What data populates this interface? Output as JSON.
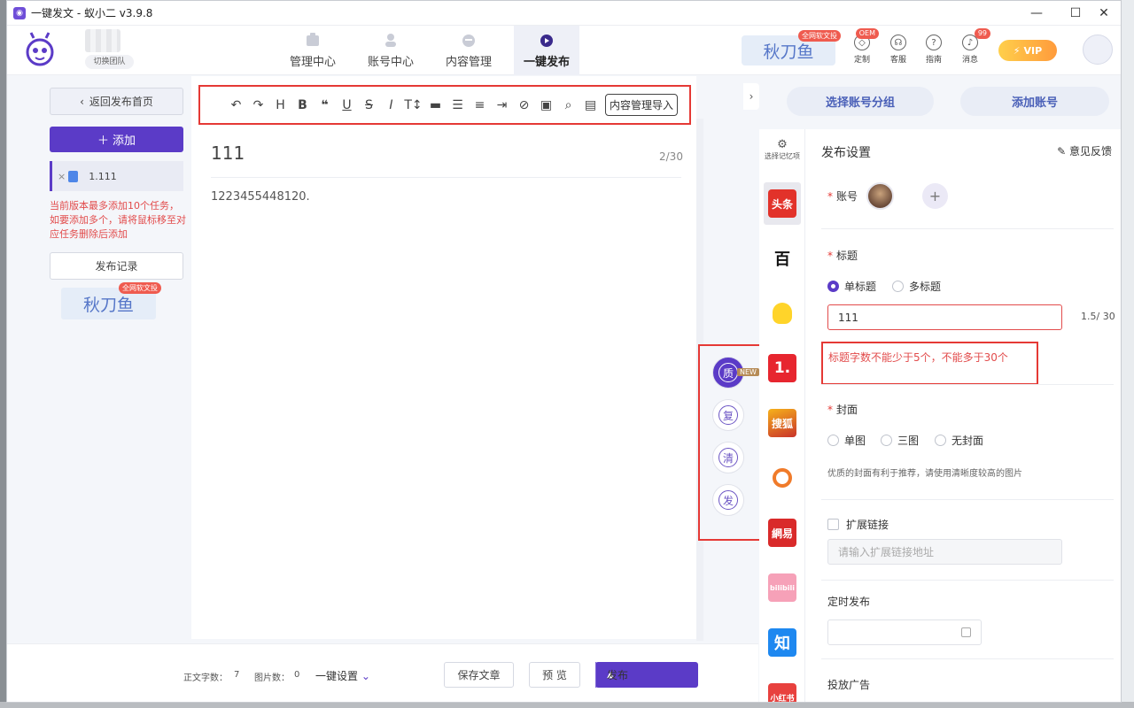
{
  "window": {
    "title": "一键发文 - 蚁小二 v3.9.8",
    "app_icon": "app-logo-icon"
  },
  "header": {
    "team_label": "切换团队",
    "nav": [
      {
        "label": "管理中心",
        "icon": "management-icon"
      },
      {
        "label": "账号中心",
        "icon": "account-icon"
      },
      {
        "label": "内容管理",
        "icon": "content-icon"
      },
      {
        "label": "一键发布",
        "icon": "publish-icon",
        "active": true
      }
    ],
    "brand": {
      "text": "秋刀鱼",
      "tag": "全网软文投"
    },
    "tools": [
      {
        "label": "定制",
        "badge": "OEM"
      },
      {
        "label": "客服",
        "badge": ""
      },
      {
        "label": "指南",
        "badge": ""
      },
      {
        "label": "消息",
        "badge": "99"
      }
    ],
    "vip_label": "VIP"
  },
  "left": {
    "back_label": "返回发布首页",
    "add_label": "添加",
    "task_item": "1.111",
    "warning": "当前版本最多添加10个任务，如要添加多个，请将鼠标移至对应任务删除后添加",
    "record_label": "发布记录",
    "brand": {
      "text": "秋刀鱼",
      "tag": "全网软文投"
    }
  },
  "editor": {
    "toolbar": [
      "undo-icon",
      "redo-icon",
      "heading-icon",
      "bold-icon",
      "quote-icon",
      "underline-icon",
      "strikethrough-icon",
      "italic-icon",
      "font-size-icon",
      "divider-icon",
      "list-icon",
      "align-left-icon",
      "indent-icon",
      "clear-format-icon",
      "image-icon",
      "search-icon",
      "import-doc-icon"
    ],
    "import_label": "内容管理导入",
    "title": "111",
    "title_count": "2/30",
    "body": "1223455448120."
  },
  "side_tools": [
    {
      "char": "质",
      "badge": "NEW"
    },
    {
      "char": "复"
    },
    {
      "char": "清"
    },
    {
      "char": "发"
    }
  ],
  "bottom": {
    "word_count_label": "正文字数：",
    "word_count": "7",
    "image_count_label": "图片数：",
    "image_count": "0",
    "one_click_settings": "一键设置",
    "save_label": "保存文章",
    "preview_label": "预 览",
    "publish_label": "发布"
  },
  "right": {
    "group_button": "选择账号分组",
    "add_account_button": "添加账号",
    "memory_label": "选择记忆项",
    "platforms": [
      {
        "name": "头条",
        "color": "#e2322a"
      },
      {
        "name": "百",
        "color": "#ffffff"
      },
      {
        "name": "企鹅",
        "color": "#ffd42a"
      },
      {
        "name": "1.",
        "color": "#e7262f"
      },
      {
        "name": "搜狐",
        "color": "#f6b21b"
      },
      {
        "name": "大鱼",
        "color": "#ffffff"
      },
      {
        "name": "網易",
        "color": "#d92a2a"
      },
      {
        "name": "bilibili",
        "color": "#f6a1b8"
      },
      {
        "name": "知",
        "color": "#1e88f0"
      },
      {
        "name": "小红书",
        "color": "#e8413e"
      }
    ],
    "settings_title": "发布设置",
    "feedback": "意见反馈",
    "account_label": "账号",
    "title_label": "标题",
    "title_mode": {
      "single": "单标题",
      "multi": "多标题"
    },
    "title_value": "111",
    "title_count": "1.5/ 30",
    "title_error": "标题字数不能少于5个，不能多于30个",
    "cover_label": "封面",
    "cover_options": [
      "单图",
      "三图",
      "无封面"
    ],
    "cover_tip": "优质的封面有利于推荐，请使用清晰度较高的图片",
    "extend_link_label": "扩展链接",
    "extend_link_placeholder": "请输入扩展链接地址",
    "schedule_label": "定时发布",
    "ads_label": "投放广告"
  }
}
